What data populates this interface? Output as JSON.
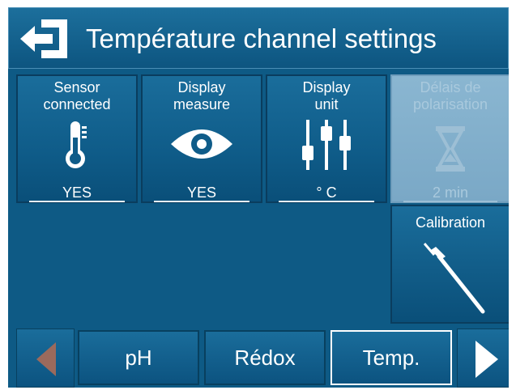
{
  "header": {
    "title": "Température channel settings",
    "back_icon": "exit-arrow-icon"
  },
  "tiles": [
    {
      "label": "Sensor\nconnected",
      "icon": "thermometer-icon",
      "value": "YES",
      "enabled": true
    },
    {
      "label": "Display\nmeasure",
      "icon": "eye-icon",
      "value": "YES",
      "enabled": true
    },
    {
      "label": "Display\nunit",
      "icon": "sliders-icon",
      "value": "° C",
      "enabled": true
    },
    {
      "label": "Délais de\npolarisation",
      "icon": "hourglass-icon",
      "value": "2 min",
      "enabled": false
    }
  ],
  "calibration": {
    "label": "Calibration",
    "icon": "probe-icon"
  },
  "nav": {
    "prev_icon": "left-arrow-icon",
    "next_icon": "right-arrow-icon",
    "tabs": [
      {
        "label": "pH",
        "active": false
      },
      {
        "label": "Rédox",
        "active": false
      },
      {
        "label": "Temp.",
        "active": true
      }
    ]
  },
  "colors": {
    "background": "#0e5a85",
    "tile": "#1a6d9b",
    "tile_disabled": "#8ab6d1",
    "text": "#ffffff",
    "text_disabled": "#a9c9dd",
    "arrow_disabled": "#9b6a5c"
  }
}
